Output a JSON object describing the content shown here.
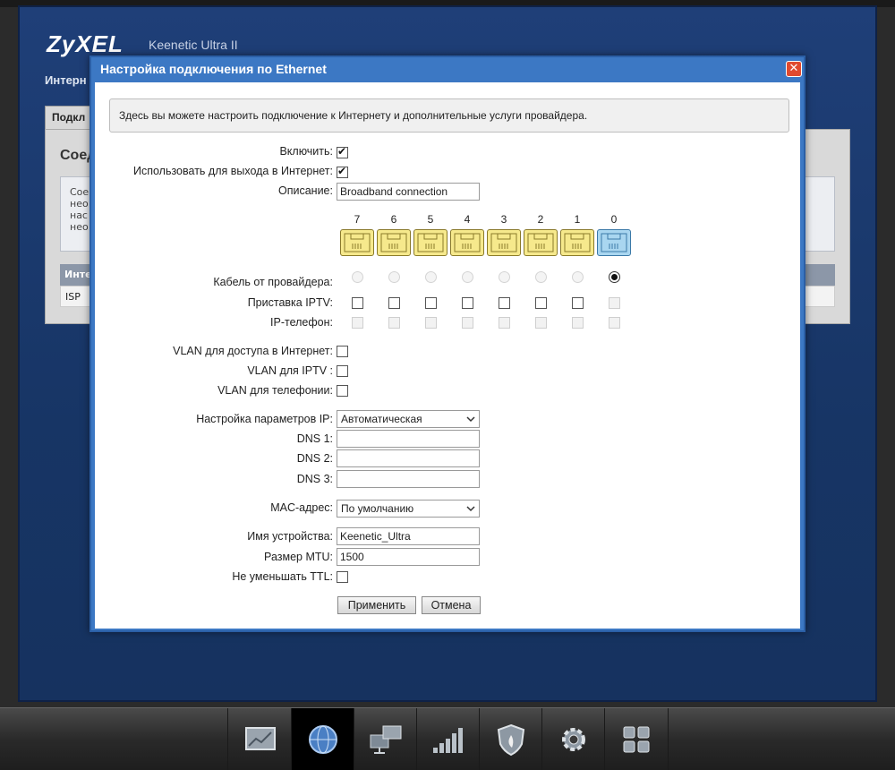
{
  "brand": "ZyXEL",
  "model": "Keenetic Ultra II",
  "page_title": "Интерн",
  "tab_label": "Подкл",
  "bg_section_title": "Соед",
  "bg_info_lines": [
    "Сое",
    "нео",
    "нас",
    "нео"
  ],
  "bg_table_header": "Инте",
  "bg_table_row": "ISP",
  "dialog": {
    "title": "Настройка подключения по Ethernet",
    "close": "✕",
    "info": "Здесь вы можете настроить подключение к Интернету и дополнительные услуги провайдера.",
    "enable_label": "Включить:",
    "use_internet_label": "Использовать для выхода в Интернет:",
    "description_label": "Описание:",
    "description_value": "Broadband connection",
    "ports": [
      "7",
      "6",
      "5",
      "4",
      "3",
      "2",
      "1",
      "0"
    ],
    "cable_label": "Кабель от провайдера:",
    "iptv_label": "Приставка IPTV:",
    "phone_label": "IP-телефон:",
    "vlan_internet_label": "VLAN для доступа в Интернет:",
    "vlan_iptv_label": "VLAN для IPTV :",
    "vlan_phone_label": "VLAN для телефонии:",
    "ip_settings_label": "Настройка параметров IP:",
    "ip_settings_value": "Автоматическая",
    "dns1_label": "DNS 1:",
    "dns2_label": "DNS 2:",
    "dns3_label": "DNS 3:",
    "mac_label": "MAC-адрес:",
    "mac_value": "По умолчанию",
    "device_name_label": "Имя устройства:",
    "device_name_value": "Keenetic_Ultra",
    "mtu_label": "Размер MTU:",
    "mtu_value": "1500",
    "ttl_label": "Не уменьшать TTL:",
    "apply": "Применить",
    "cancel": "Отмена"
  },
  "colors": {
    "port_yellow": "#f6e98c",
    "port_active": "#a9d6f0",
    "title_bar": "#3c78c4",
    "close": "#e04a2f"
  },
  "taskbar_icons": [
    "chart-icon",
    "globe-icon",
    "network-icon",
    "signal-bars-icon",
    "shield-icon",
    "gear-icon",
    "apps-grid-icon"
  ]
}
